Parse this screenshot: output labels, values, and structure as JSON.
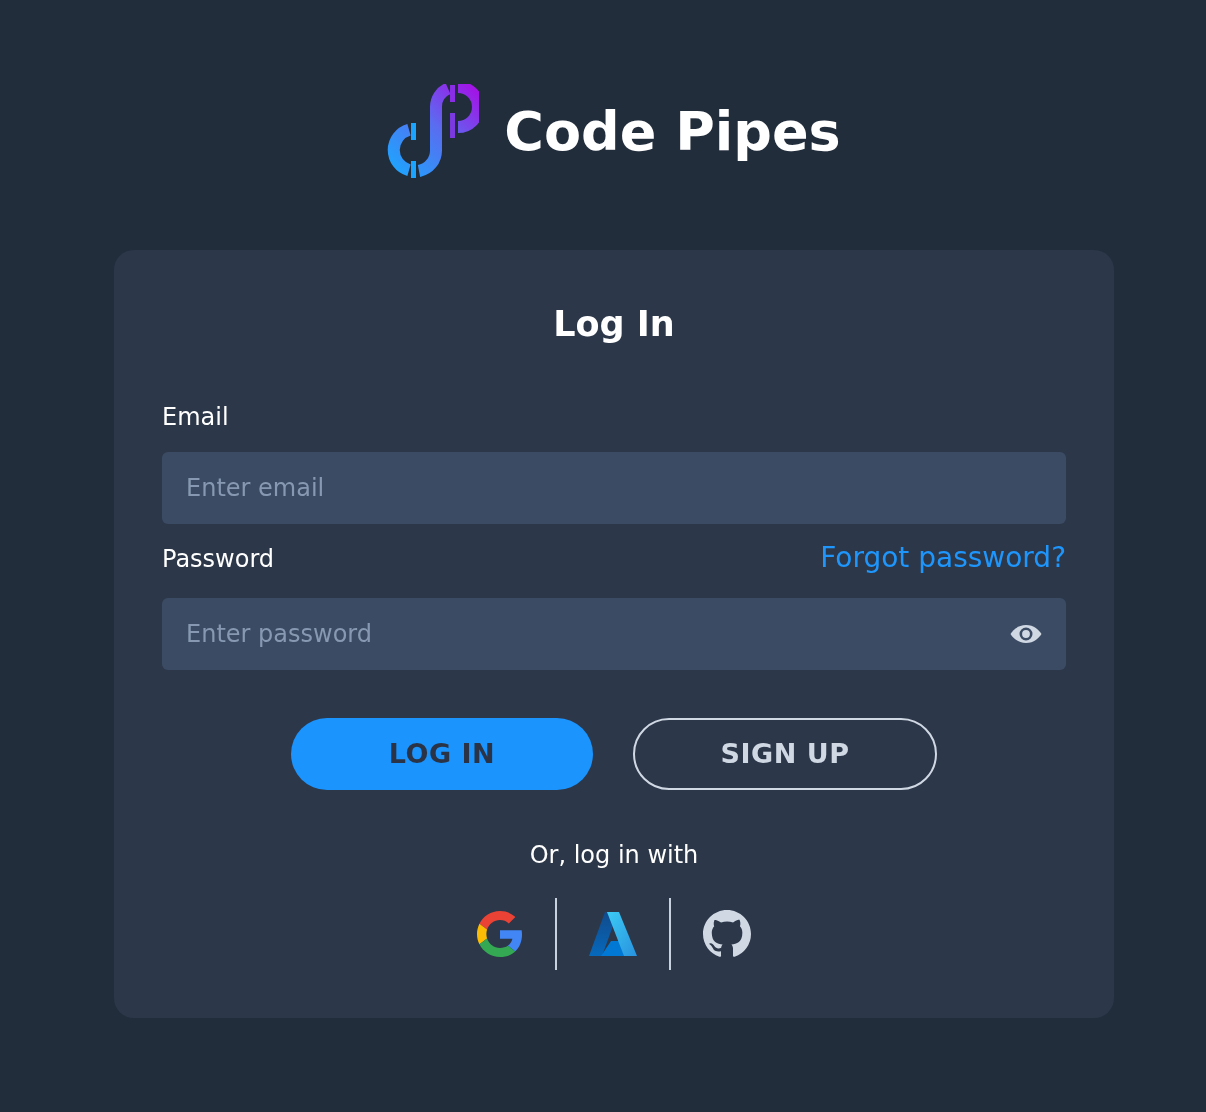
{
  "logo": {
    "name": "Code Pipes"
  },
  "form": {
    "title": "Log In",
    "fields": [
      {
        "kind": "email",
        "label": "Email",
        "placeholder": "Enter email"
      },
      {
        "kind": "password",
        "label": "Password",
        "placeholder": "Enter password",
        "link": "Forgot password?"
      }
    ],
    "buttons": [
      {
        "kind": "primary",
        "label": "LOG IN"
      },
      {
        "kind": "outline",
        "label": "SIGN UP"
      }
    ],
    "social": {
      "caption": "Or, log in with",
      "providers": [
        {
          "kind": "google"
        },
        {
          "kind": "azure"
        },
        {
          "kind": "github"
        }
      ]
    }
  }
}
